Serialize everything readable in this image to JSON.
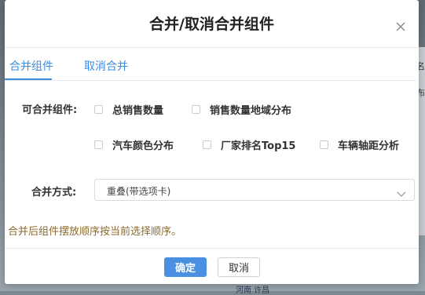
{
  "dialog": {
    "title": "合并/取消合并组件",
    "tabs": [
      {
        "label": "合并组件"
      },
      {
        "label": "取消合并"
      }
    ],
    "merge_label": "可合并组件:",
    "components": [
      {
        "label": "总销售数量",
        "checked": false
      },
      {
        "label": "销售数量地域分布",
        "checked": false
      },
      {
        "label": "汽车颜色分布",
        "checked": false
      },
      {
        "label": "厂家排名Top15",
        "checked": false
      },
      {
        "label": "车辆轴距分析",
        "checked": false
      }
    ],
    "mode_label": "合并方式:",
    "mode_value": "重叠(带选项卡)",
    "hint": "合并后组件摆放顺序按当前选择顺序。",
    "ok_label": "确定",
    "cancel_label": "取消"
  },
  "background": {
    "right_glyphs": [
      "名",
      "布"
    ],
    "bottom_text": "河南 许昌"
  },
  "colors": {
    "accent": "#4a90e2",
    "tab_text": "#3b8ee0",
    "hint": "#8c6a2f"
  },
  "icons": {
    "close": "close-icon",
    "dropdown": "chevron-down-icon"
  }
}
